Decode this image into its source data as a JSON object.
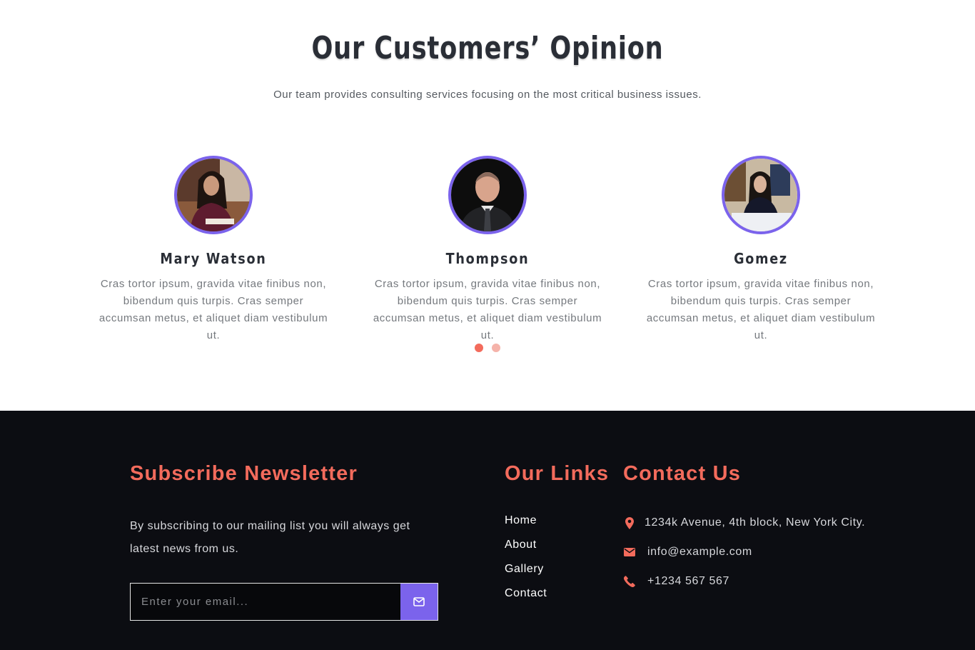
{
  "testimonials": {
    "title": "Our Customers’ Opinion",
    "subtitle": "Our team provides consulting services focusing on the most critical business issues.",
    "cards": [
      {
        "name": "Mary Watson",
        "text": "Cras tortor ipsum, gravida vitae finibus non, bibendum quis turpis. Cras semper accumsan metus, et aliquet diam vestibulum ut."
      },
      {
        "name": "Thompson",
        "text": "Cras tortor ipsum, gravida vitae finibus non, bibendum quis turpis. Cras semper accumsan metus, et aliquet diam vestibulum ut."
      },
      {
        "name": "Gomez",
        "text": "Cras tortor ipsum, gravida vitae finibus non, bibendum quis turpis. Cras semper accumsan metus, et aliquet diam vestibulum ut."
      }
    ],
    "active_page": 1,
    "page_count": 2
  },
  "footer": {
    "newsletter": {
      "title": "Subscribe Newsletter",
      "description": "By subscribing to our mailing list you will always get latest news from us.",
      "placeholder": "Enter your email...",
      "button_icon": "envelope-icon"
    },
    "links": {
      "title": "Our Links",
      "items": [
        "Home",
        "About",
        "Gallery",
        "Contact"
      ]
    },
    "contact": {
      "title": "Contact Us",
      "address": "1234k Avenue, 4th block, New York City.",
      "email": "info@example.com",
      "phone": "+1234 567 567",
      "icons": [
        "map-marker-icon",
        "envelope-icon",
        "phone-icon"
      ]
    }
  },
  "colors": {
    "accent": "#f36b5c",
    "accent_light": "#f5b3aa",
    "purple": "#7b63ec",
    "footer_bg": "#0c0d12",
    "heading": "#2a2e36"
  }
}
